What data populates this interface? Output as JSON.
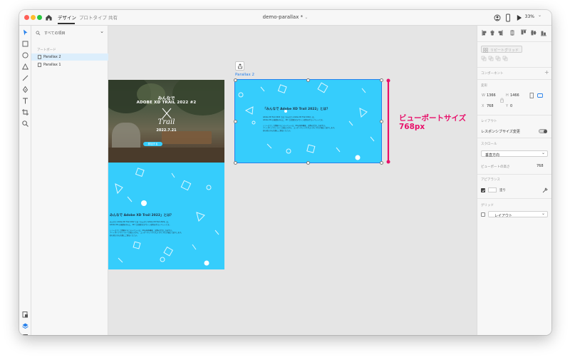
{
  "titlebar": {
    "tabs": [
      {
        "label": "デザイン",
        "active": true
      },
      {
        "label": "プロトタイプ",
        "active": false
      },
      {
        "label": "共有",
        "active": false
      }
    ],
    "document_title": "demo-parallax *",
    "zoom": "33%"
  },
  "layers": {
    "search_placeholder": "すべての項目",
    "section_label": "アートボード",
    "items": [
      {
        "label": "Parallax 2",
        "selected": true
      },
      {
        "label": "Parallax 1",
        "selected": false
      }
    ]
  },
  "canvas": {
    "artboard1": {
      "hero_title_line1": "みんなで",
      "hero_title_line2": "ADOBE XD TRAIL 2022 #2",
      "hero_script": "Trail",
      "hero_date": "2022.7.21",
      "hero_button": "参加する",
      "section_heading": "みんなで Adobe XD Trail 2022」とは？",
      "body_lines": [
        "みんなで Adobe XD Trail 2022 では「みんなで Adobe XD Trail 2022」は、",
        "Adobe XD の基礎を中心に、XD で実践的なデザイン制作を学ぶイベントです。",
        "",
        "シリーズとして開催するこのイベントは、XDの基本機能、実際の活かし方を学ぶ。",
        "アートボードやレイヤーの扱い方から、コンポーネントやプロトタイプなど幅広く紹介します。",
        "初心者の方も気軽にご参加ください。"
      ]
    },
    "artboard2": {
      "label": "Parallax 2",
      "heading": "「みんなで Adobe XD Trail 2022」とは？",
      "body_lines": [
        "Adobe XD Trail 2022 では「みんなで Adobe XD Trail 2022」は、",
        "Adobe XD の基礎を中心に、XD で実践的なデザイン制作を学ぶイベントです。",
        "",
        "シリーズとして開催するこのイベントは、XDの基本機能、実際の活かし方を学ぶ。",
        "アートボードやレイヤーの扱い方から、コンポーネントやプロトタイプなど幅広く紹介します。",
        "初心者の方も気軽にご参加ください。"
      ]
    },
    "annotation": {
      "line1": "ビューポートサイズ",
      "line2": "768px",
      "color": "#e8106a"
    }
  },
  "properties": {
    "repeat_grid": "リピートグリッド",
    "component_label": "コンポーネント",
    "transform_label": "変形",
    "w_label": "W",
    "w_value": "1366",
    "h_label": "H",
    "h_value": "1466",
    "x_label": "X",
    "x_value": "768",
    "y_label": "Y",
    "y_value": "0",
    "layout_label": "レイアウト",
    "responsive_label": "レスポンシブサイズ変更",
    "scroll_label": "スクロール",
    "scroll_value": "垂直方向",
    "viewport_height_label": "ビューポートの高さ",
    "viewport_height_value": "768",
    "appearance_label": "アピアランス",
    "fill_label": "塗り",
    "grid_label": "グリッド",
    "grid_value": "レイアウト"
  },
  "colors": {
    "accent": "#2680eb",
    "artboard_blue": "#36cdfc",
    "annotation": "#e8106a",
    "canvas_bg": "#e5e5e5",
    "panel_bg": "#f7f7f7"
  }
}
